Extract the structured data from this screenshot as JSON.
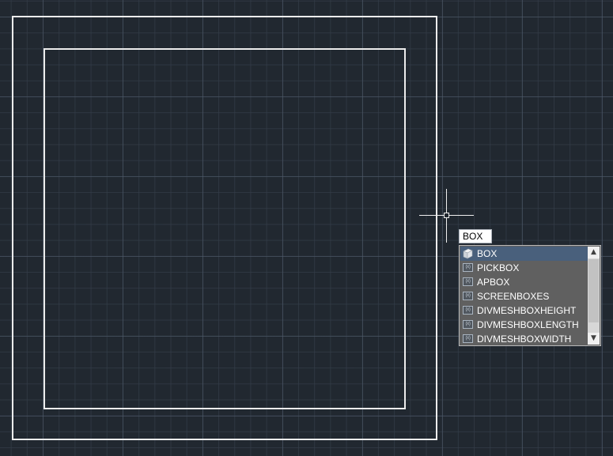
{
  "command_line": {
    "input_value": "BOX"
  },
  "autocomplete": {
    "selected_index": 0,
    "items": [
      {
        "label": "BOX",
        "icon": "box-3d-icon"
      },
      {
        "label": "PICKBOX",
        "icon": "system-variable-icon"
      },
      {
        "label": "APBOX",
        "icon": "system-variable-icon"
      },
      {
        "label": "SCREENBOXES",
        "icon": "system-variable-icon"
      },
      {
        "label": "DIVMESHBOXHEIGHT",
        "icon": "system-variable-icon"
      },
      {
        "label": "DIVMESHBOXLENGTH",
        "icon": "system-variable-icon"
      },
      {
        "label": "DIVMESHBOXWIDTH",
        "icon": "system-variable-icon"
      }
    ],
    "scroll_up_glyph": "▲",
    "scroll_down_glyph": "▼",
    "sysvar_icon_glyph": "(x)"
  },
  "colors": {
    "background": "#212830",
    "geometry": "#ececec",
    "selection": "#49607c",
    "list_background": "#606060"
  }
}
